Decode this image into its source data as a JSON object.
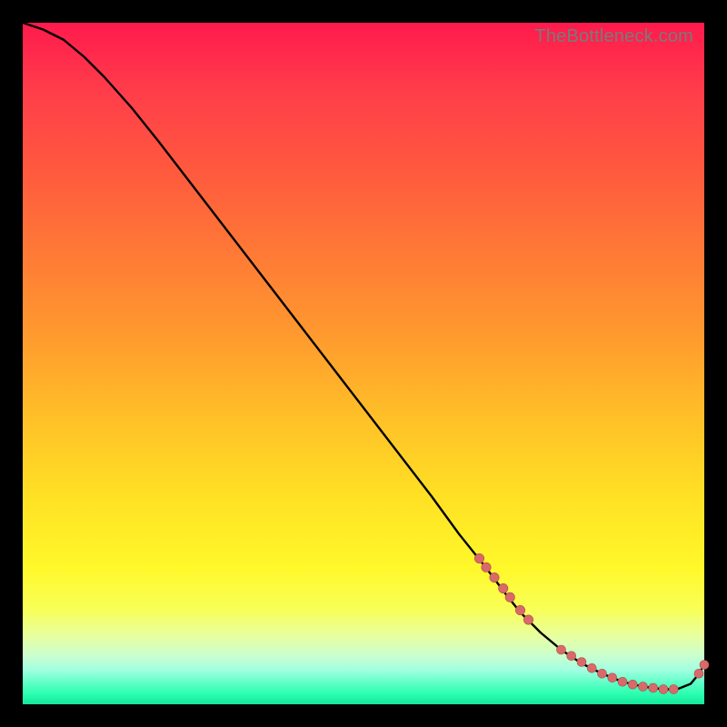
{
  "watermark": "TheBottleneck.com",
  "cluster_label": "",
  "colors": {
    "curve": "#000000",
    "marker_fill": "#d86a6a",
    "marker_stroke": "#b04848"
  },
  "chart_data": {
    "type": "line",
    "title": "",
    "xlabel": "",
    "ylabel": "",
    "xlim": [
      0,
      100
    ],
    "ylim": [
      0,
      100
    ],
    "series": [
      {
        "name": "bottleneck-curve",
        "x": [
          0,
          3,
          6,
          9,
          12,
          16,
          20,
          25,
          30,
          35,
          40,
          45,
          50,
          55,
          60,
          64,
          68,
          71,
          73,
          76,
          79,
          82,
          85,
          88,
          91,
          94,
          96,
          98,
          99,
          100
        ],
        "y": [
          100,
          99,
          97.5,
          95,
          92,
          87.5,
          82.5,
          76,
          69.5,
          63,
          56.5,
          50,
          43.5,
          37,
          30.5,
          25,
          20,
          16,
          13.5,
          10.5,
          8,
          6,
          4.5,
          3.3,
          2.6,
          2.2,
          2.2,
          3.0,
          4.2,
          5.8
        ]
      }
    ],
    "markers": [
      {
        "group": "upper-segment",
        "points": [
          {
            "x": 67,
            "y": 21.4
          },
          {
            "x": 68,
            "y": 20.1
          },
          {
            "x": 69.2,
            "y": 18.6
          },
          {
            "x": 70.5,
            "y": 17.0
          },
          {
            "x": 71.5,
            "y": 15.7
          },
          {
            "x": 73,
            "y": 13.8
          },
          {
            "x": 74.2,
            "y": 12.4
          }
        ]
      },
      {
        "group": "valley-cluster",
        "points": [
          {
            "x": 79,
            "y": 8.0
          },
          {
            "x": 80.5,
            "y": 7.1
          },
          {
            "x": 82,
            "y": 6.2
          },
          {
            "x": 83.5,
            "y": 5.3
          },
          {
            "x": 85,
            "y": 4.5
          },
          {
            "x": 86.5,
            "y": 3.9
          },
          {
            "x": 88,
            "y": 3.3
          },
          {
            "x": 89.5,
            "y": 2.9
          },
          {
            "x": 91,
            "y": 2.6
          },
          {
            "x": 92.5,
            "y": 2.4
          },
          {
            "x": 94,
            "y": 2.2
          },
          {
            "x": 95.5,
            "y": 2.2
          }
        ]
      },
      {
        "group": "right-tail",
        "points": [
          {
            "x": 99.2,
            "y": 4.5
          },
          {
            "x": 100,
            "y": 5.8
          }
        ]
      }
    ],
    "annotations": [
      {
        "text": "",
        "x": 86,
        "y": 4.2
      }
    ]
  }
}
